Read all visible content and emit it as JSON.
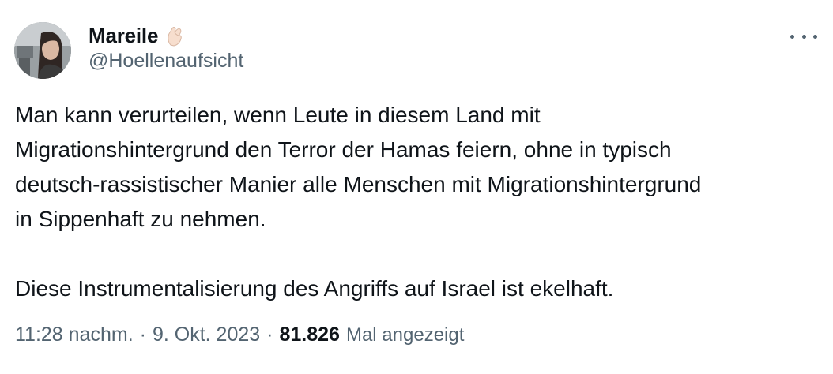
{
  "author": {
    "display_name": "Mareile",
    "handle": "@Hoellenaufsicht",
    "badge_icon": "pinching-hand-emoji-icon"
  },
  "tweet": {
    "text": "Man kann verurteilen, wenn Leute in diesem Land mit\nMigrationshintergrund den Terror der Hamas feiern, ohne in typisch\ndeutsch-rassistischer Manier alle Menschen mit Migrationshintergrund\nin Sippenhaft zu nehmen.\n\nDiese Instrumentalisierung des Angriffs auf Israel ist ekelhaft."
  },
  "meta": {
    "time": "11:28 nachm.",
    "separator": "·",
    "date": "9. Okt. 2023",
    "views_count": "81.826",
    "views_label": "Mal angezeigt"
  },
  "colors": {
    "text_primary": "#0f1419",
    "text_secondary": "#536471",
    "background": "#ffffff"
  }
}
